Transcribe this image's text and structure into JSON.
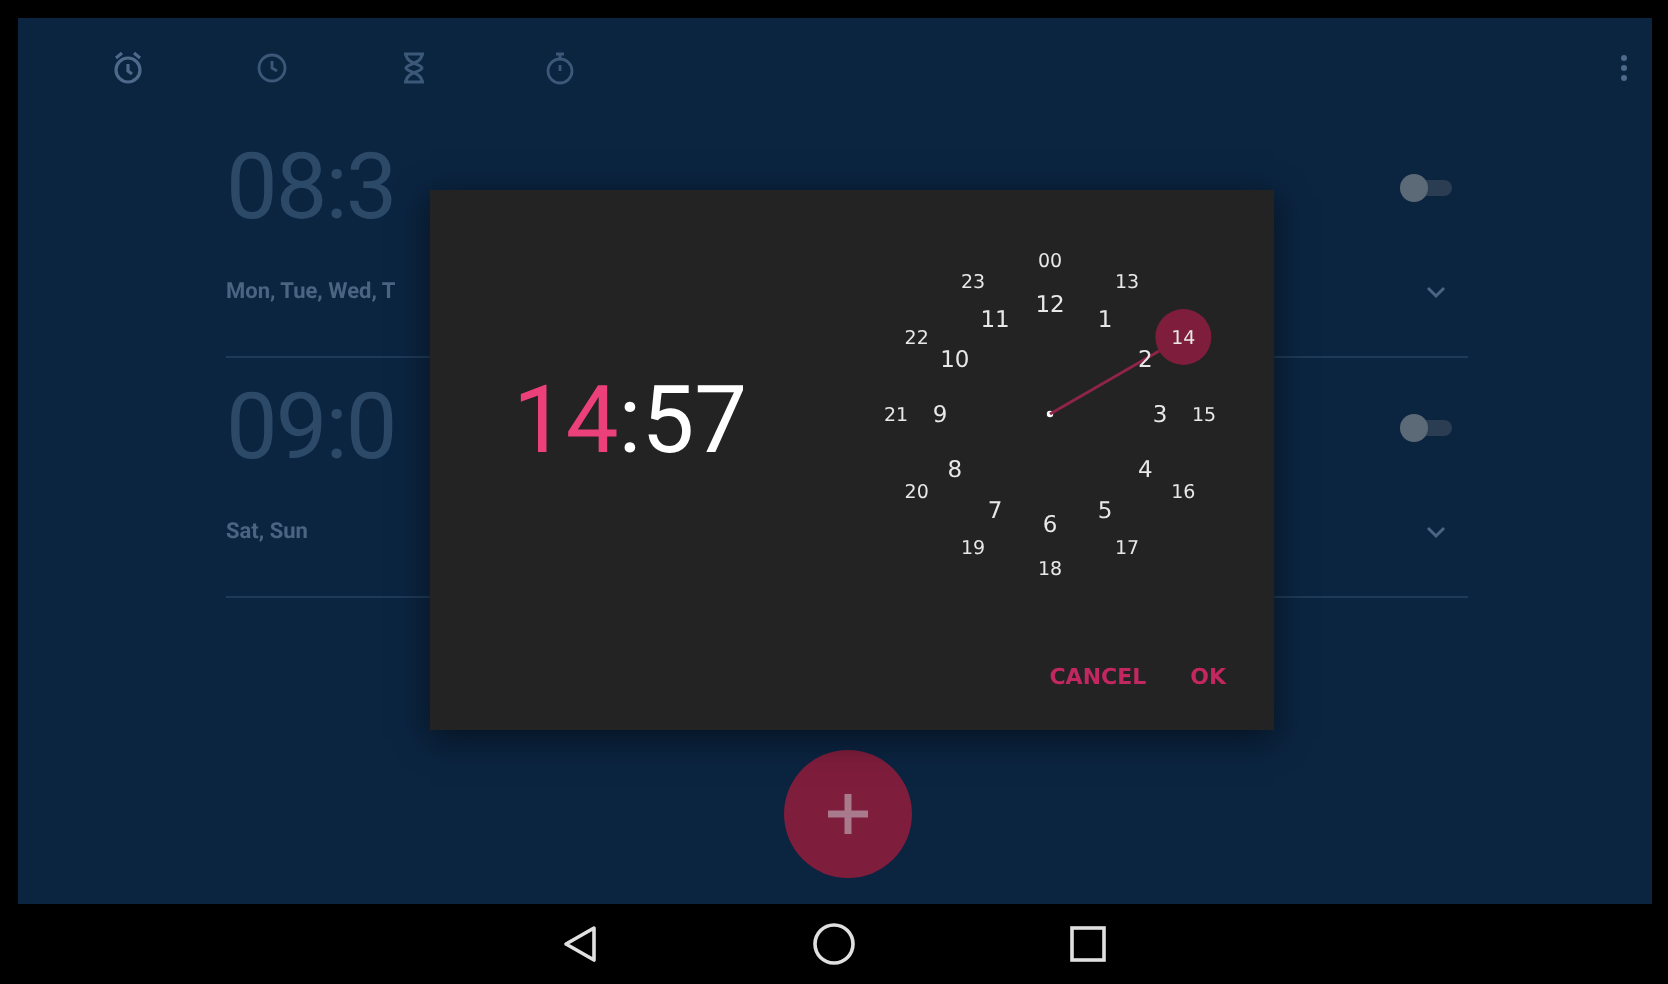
{
  "alarms": [
    {
      "time": "08:3",
      "days": "Mon, Tue, Wed, T",
      "on": false
    },
    {
      "time": "09:0",
      "days": "Sat, Sun",
      "on": false
    }
  ],
  "dialog": {
    "hour": "14",
    "separator": ":",
    "minute": "57",
    "hour_selected": true,
    "dial_inner": [
      {
        "label": "12",
        "selected": false
      },
      {
        "label": "1",
        "selected": false
      },
      {
        "label": "2",
        "selected": false
      },
      {
        "label": "3",
        "selected": false
      },
      {
        "label": "4",
        "selected": false
      },
      {
        "label": "5",
        "selected": false
      },
      {
        "label": "6",
        "selected": false
      },
      {
        "label": "7",
        "selected": false
      },
      {
        "label": "8",
        "selected": false
      },
      {
        "label": "9",
        "selected": false
      },
      {
        "label": "10",
        "selected": false
      },
      {
        "label": "11",
        "selected": false
      }
    ],
    "dial_outer": [
      {
        "label": "00",
        "selected": false
      },
      {
        "label": "13",
        "selected": false
      },
      {
        "label": "14",
        "selected": true
      },
      {
        "label": "15",
        "selected": false
      },
      {
        "label": "16",
        "selected": false
      },
      {
        "label": "17",
        "selected": false
      },
      {
        "label": "18",
        "selected": false
      },
      {
        "label": "19",
        "selected": false
      },
      {
        "label": "20",
        "selected": false
      },
      {
        "label": "21",
        "selected": false
      },
      {
        "label": "22",
        "selected": false
      },
      {
        "label": "23",
        "selected": false
      }
    ],
    "buttons": [
      "CANCEL",
      "OK"
    ]
  }
}
